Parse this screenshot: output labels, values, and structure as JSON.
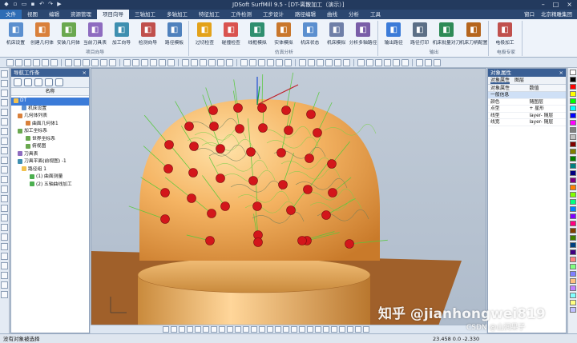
{
  "window": {
    "title": "JDSoft SurfMill 9.5 - [DT-离散加工（演示）]",
    "controls": [
      "–",
      "□",
      "×"
    ]
  },
  "tabs": [
    {
      "label": "文件"
    },
    {
      "label": "视图"
    },
    {
      "label": "编辑"
    },
    {
      "label": "资源管理"
    },
    {
      "label": "项目向导"
    },
    {
      "label": "三轴加工"
    },
    {
      "label": "多轴加工"
    },
    {
      "label": "特征加工"
    },
    {
      "label": "工件检测"
    },
    {
      "label": "工步设计"
    },
    {
      "label": "路径编辑"
    },
    {
      "label": "曲线"
    },
    {
      "label": "分析"
    },
    {
      "label": "工具"
    }
  ],
  "tabs_right": {
    "window": "窗口",
    "company": "北京精雕集团"
  },
  "ribbon": {
    "groups": [
      {
        "label": "项目向导",
        "buttons": [
          {
            "label": "机床设置",
            "icon": "machine-icon",
            "color": "#5b8fcf"
          },
          {
            "label": "创建几何体",
            "icon": "geometry-icon",
            "color": "#d9803b"
          },
          {
            "label": "安装几何体",
            "icon": "install-icon",
            "color": "#6aa84f"
          },
          {
            "label": "当前刀具表",
            "icon": "tool-table-icon",
            "color": "#8e6cc0"
          },
          {
            "label": "加工向导",
            "icon": "wizard-icon",
            "color": "#3e8fb0"
          },
          {
            "label": "检测向导",
            "icon": "inspect-icon",
            "color": "#c0504d"
          },
          {
            "label": "路径模板",
            "icon": "template-icon",
            "color": "#4f81bd"
          }
        ]
      },
      {
        "label": "仿真分析",
        "buttons": [
          {
            "label": "过切检查",
            "icon": "overcut-icon",
            "color": "#e3a21a"
          },
          {
            "label": "碰撞检查",
            "icon": "collision-icon",
            "color": "#d9534f"
          },
          {
            "label": "线框模拟",
            "icon": "wireframe-icon",
            "color": "#2f8f6f"
          },
          {
            "label": "实体模拟",
            "icon": "solid-sim-icon",
            "color": "#c9772c"
          },
          {
            "label": "机床状态",
            "icon": "machine-state-icon",
            "color": "#5b8fcf"
          },
          {
            "label": "机床模拟",
            "icon": "machine-sim-icon",
            "color": "#6f7fa8"
          },
          {
            "label": "分析多轴路径",
            "icon": "analyze-path-icon",
            "color": "#7a5ea8"
          }
        ]
      },
      {
        "label": "输出",
        "buttons": [
          {
            "label": "输出路径",
            "icon": "output-path-icon",
            "color": "#3b7bd8"
          },
          {
            "label": "路径打印",
            "icon": "print-icon",
            "color": "#5c6f86"
          },
          {
            "label": "机床批量对刀",
            "icon": "batch-tool-icon",
            "color": "#2e8b57"
          },
          {
            "label": "机床刀柄配置",
            "icon": "holder-icon",
            "color": "#b5651d"
          }
        ]
      },
      {
        "label": "电极专家",
        "buttons": [
          {
            "label": "电极加工",
            "icon": "electrode-icon",
            "color": "#c0504d"
          }
        ]
      }
    ]
  },
  "navigator": {
    "title": "导航工作条",
    "close": "×",
    "column": "名称",
    "tree": [
      {
        "label": "DT",
        "indent": 0,
        "selected": true,
        "color": "#f2c14e"
      },
      {
        "label": "机床设置",
        "indent": 2,
        "color": "#5b8fcf"
      },
      {
        "label": "几何体列表",
        "indent": 1,
        "color": "#d9803b"
      },
      {
        "label": "曲面几何体1",
        "indent": 3,
        "color": "#d9803b"
      },
      {
        "label": "加工坐标系",
        "indent": 1,
        "color": "#6aa84f"
      },
      {
        "label": "世界坐标系",
        "indent": 3,
        "color": "#6aa84f"
      },
      {
        "label": "俯视图",
        "indent": 3,
        "color": "#6aa84f"
      },
      {
        "label": "刀具表",
        "indent": 1,
        "color": "#8e6cc0"
      },
      {
        "label": "刀具平面(前视图) -1",
        "indent": 1,
        "color": "#3e8fb0"
      },
      {
        "label": "路径组 1",
        "indent": 2,
        "color": "#f2c14e"
      },
      {
        "label": "(1) 曲面测量",
        "indent": 4,
        "color": "#4caf50"
      },
      {
        "label": "(2) 五轴曲线加工",
        "indent": 4,
        "color": "#4caf50"
      }
    ]
  },
  "properties": {
    "title": "对象属性",
    "close": "×",
    "tabs": [
      "对象属性",
      "图层"
    ],
    "headers": [
      "对象属性",
      "数值"
    ],
    "rows": [
      {
        "name": "一般信息",
        "value": "",
        "selected": true
      },
      {
        "name": "颜色",
        "value": "随图层"
      },
      {
        "name": "点型",
        "value": "+ 星形"
      },
      {
        "name": "线型",
        "value": "layer- 随层"
      },
      {
        "name": "线宽",
        "value": "layer- 随层"
      }
    ]
  },
  "palette": [
    "#ffffff",
    "#000000",
    "#ff0000",
    "#ffff00",
    "#00ff00",
    "#00ffff",
    "#0000ff",
    "#ff00ff",
    "#808080",
    "#c0c0c0",
    "#800000",
    "#808000",
    "#008000",
    "#008080",
    "#000080",
    "#800080",
    "#ff8000",
    "#80ff00",
    "#00ff80",
    "#0080ff",
    "#8000ff",
    "#ff0080",
    "#804000",
    "#408000",
    "#004080",
    "#400080",
    "#ff8080",
    "#80ff80",
    "#8080ff",
    "#ffc080",
    "#c080ff",
    "#80ffff",
    "#ffff80",
    "#c0c0ff"
  ],
  "status": {
    "left": "没有对象被选择",
    "coords": "23.458  0.0  -2.330"
  },
  "watermark": {
    "main": "知乎 @jianhongwei819",
    "sub": "CSDN @山涧果子"
  }
}
